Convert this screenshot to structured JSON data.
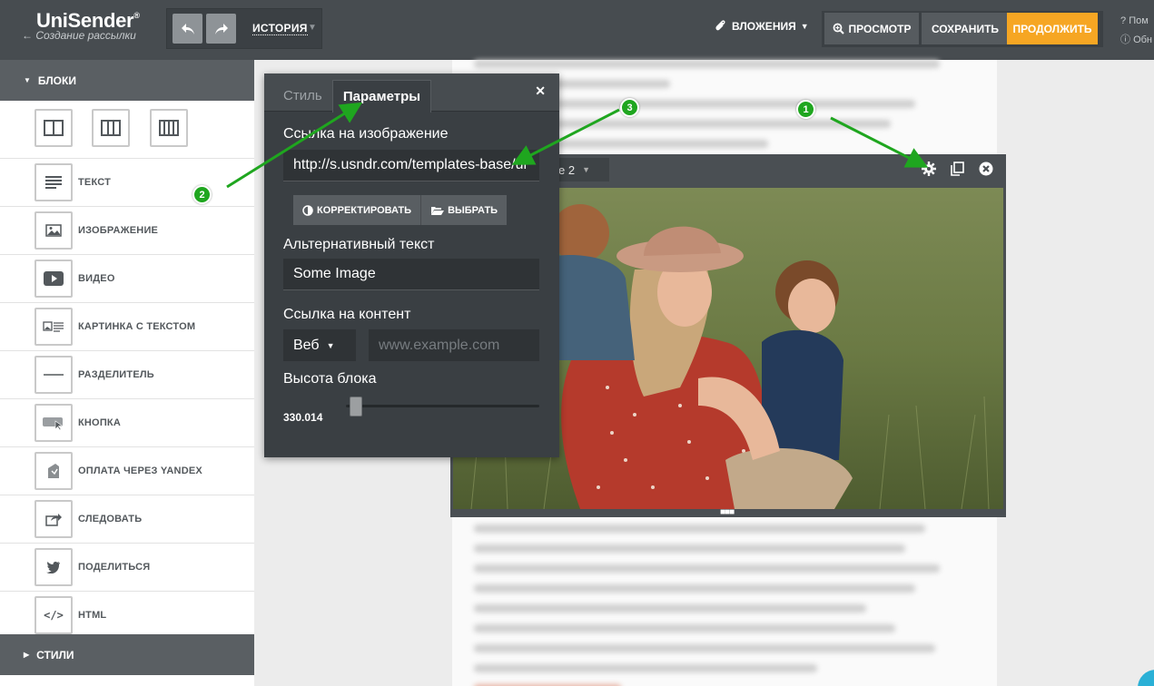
{
  "header": {
    "logo": "UniSender",
    "back_link": "← Создание рассылки",
    "history_label": "ИСТОРИЯ",
    "attachments_label": "ВЛОЖЕНИЯ",
    "preview_label": "ПРОСМОТР",
    "save_label": "СОХРАНИТЬ",
    "continue_label": "ПРОДОЛЖИТЬ",
    "help_links": [
      "Пом",
      "Обн"
    ]
  },
  "sidebar": {
    "blocks_title": "БЛОКИ",
    "items": [
      {
        "label": "ТЕКСТ",
        "icon": "text-icon"
      },
      {
        "label": "ИЗОБРАЖЕНИЕ",
        "icon": "image-icon"
      },
      {
        "label": "ВИДЕО",
        "icon": "video-icon"
      },
      {
        "label": "КАРТИНКА С ТЕКСТОМ",
        "icon": "image-text-icon"
      },
      {
        "label": "РАЗДЕЛИТЕЛЬ",
        "icon": "divider-icon"
      },
      {
        "label": "КНОПКА",
        "icon": "button-icon"
      },
      {
        "label": "ОПЛАТА ЧЕРЕЗ YANDEX",
        "icon": "payment-icon"
      },
      {
        "label": "СЛЕДОВАТЬ",
        "icon": "follow-icon"
      },
      {
        "label": "ПОДЕЛИТЬСЯ",
        "icon": "twitter-icon"
      },
      {
        "label": "HTML",
        "icon": "code-icon"
      }
    ],
    "styles_title": "СТИЛИ"
  },
  "block_toolbar": {
    "select_value": "e 2"
  },
  "popup": {
    "tab_style": "Стиль",
    "tab_params": "Параметры",
    "image_url_label": "Ссылка на изображение",
    "image_url_value": "http://s.usndr.com/templates-base/ur",
    "correct_button": "КОРРЕКТИРОВАТЬ",
    "choose_button": "ВЫБРАТЬ",
    "alt_label": "Альтернативный текст",
    "alt_value": "Some Image",
    "content_link_label": "Ссылка на контент",
    "link_type": "Веб",
    "link_placeholder": "www.example.com",
    "height_label": "Высота блока",
    "height_value": "330.014"
  },
  "annotations": [
    "1",
    "2",
    "3"
  ],
  "colors": {
    "accent": "#f6a623",
    "topbar": "#474c50",
    "arrow": "#1fa61f"
  }
}
